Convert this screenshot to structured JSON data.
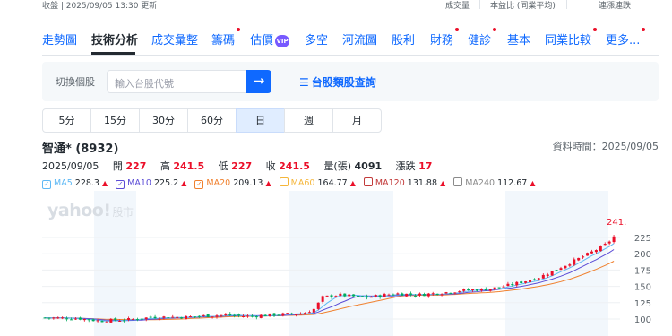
{
  "topbar": {
    "status": "收盤 | 2025/09/05 13:30 更新",
    "link1": "成交量",
    "link2": "本益比 (同業平均)",
    "link3": "連漲連跌"
  },
  "tabs": [
    {
      "label": "走勢圖",
      "dot": false,
      "vip": false
    },
    {
      "label": "技術分析",
      "dot": false,
      "vip": false,
      "active": true
    },
    {
      "label": "成交彙整",
      "dot": false,
      "vip": false
    },
    {
      "label": "籌碼",
      "dot": true,
      "vip": false
    },
    {
      "label": "估價",
      "dot": false,
      "vip": true
    },
    {
      "label": "多空",
      "dot": false,
      "vip": false
    },
    {
      "label": "河流圖",
      "dot": false,
      "vip": false
    },
    {
      "label": "股利",
      "dot": false,
      "vip": false
    },
    {
      "label": "財務",
      "dot": true,
      "vip": false
    },
    {
      "label": "健診",
      "dot": true,
      "vip": false
    },
    {
      "label": "基本",
      "dot": false,
      "vip": false
    },
    {
      "label": "同業比較",
      "dot": true,
      "vip": false
    },
    {
      "label": "更多...",
      "dot": true,
      "vip": false
    }
  ],
  "search": {
    "label": "切換個股",
    "placeholder": "輸入台股代號",
    "go_icon": "arrow-right-icon",
    "category_icon": "list-icon",
    "category_label": "台股類股查詢"
  },
  "periods": [
    "5分",
    "15分",
    "30分",
    "60分",
    "日",
    "週",
    "月"
  ],
  "active_period": "日",
  "stock": {
    "name": "智通* (8932)",
    "data_time": "資料時間：2025/09/05",
    "date": "2025/09/05",
    "open_label": "開",
    "open": "227",
    "high_label": "高",
    "high": "241.5",
    "low_label": "低",
    "low": "227",
    "close_label": "收",
    "close": "241.5",
    "volume_label": "量(張)",
    "volume": "4091",
    "change_label": "漲跌",
    "change": "17"
  },
  "ma_legend": [
    {
      "label": "MA5",
      "value": "228.3",
      "color": "#5fb9f5",
      "checked": true
    },
    {
      "label": "MA10",
      "value": "225.2",
      "color": "#5b4cd6",
      "checked": true
    },
    {
      "label": "MA20",
      "value": "209.13",
      "color": "#f0812f",
      "checked": true
    },
    {
      "label": "MA60",
      "value": "164.77",
      "color": "#f5b63a",
      "checked": false
    },
    {
      "label": "MA120",
      "value": "131.88",
      "color": "#c23a3a",
      "checked": false
    },
    {
      "label": "MA240",
      "value": "112.67",
      "color": "#8a8a8a",
      "checked": false
    }
  ],
  "watermark": {
    "brand": "yahoo!",
    "sub": "股市"
  },
  "colors": {
    "accent": "#0f69ff",
    "up": "#eb0f29",
    "down": "#00ab5e",
    "band": "#f2f7fc"
  },
  "chart_data": {
    "type": "candlestick",
    "y_ticks": [
      225,
      200,
      175,
      150,
      125,
      100
    ],
    "last_price_label": "241.",
    "ma_series": [
      "MA5",
      "MA10",
      "MA20"
    ]
  }
}
